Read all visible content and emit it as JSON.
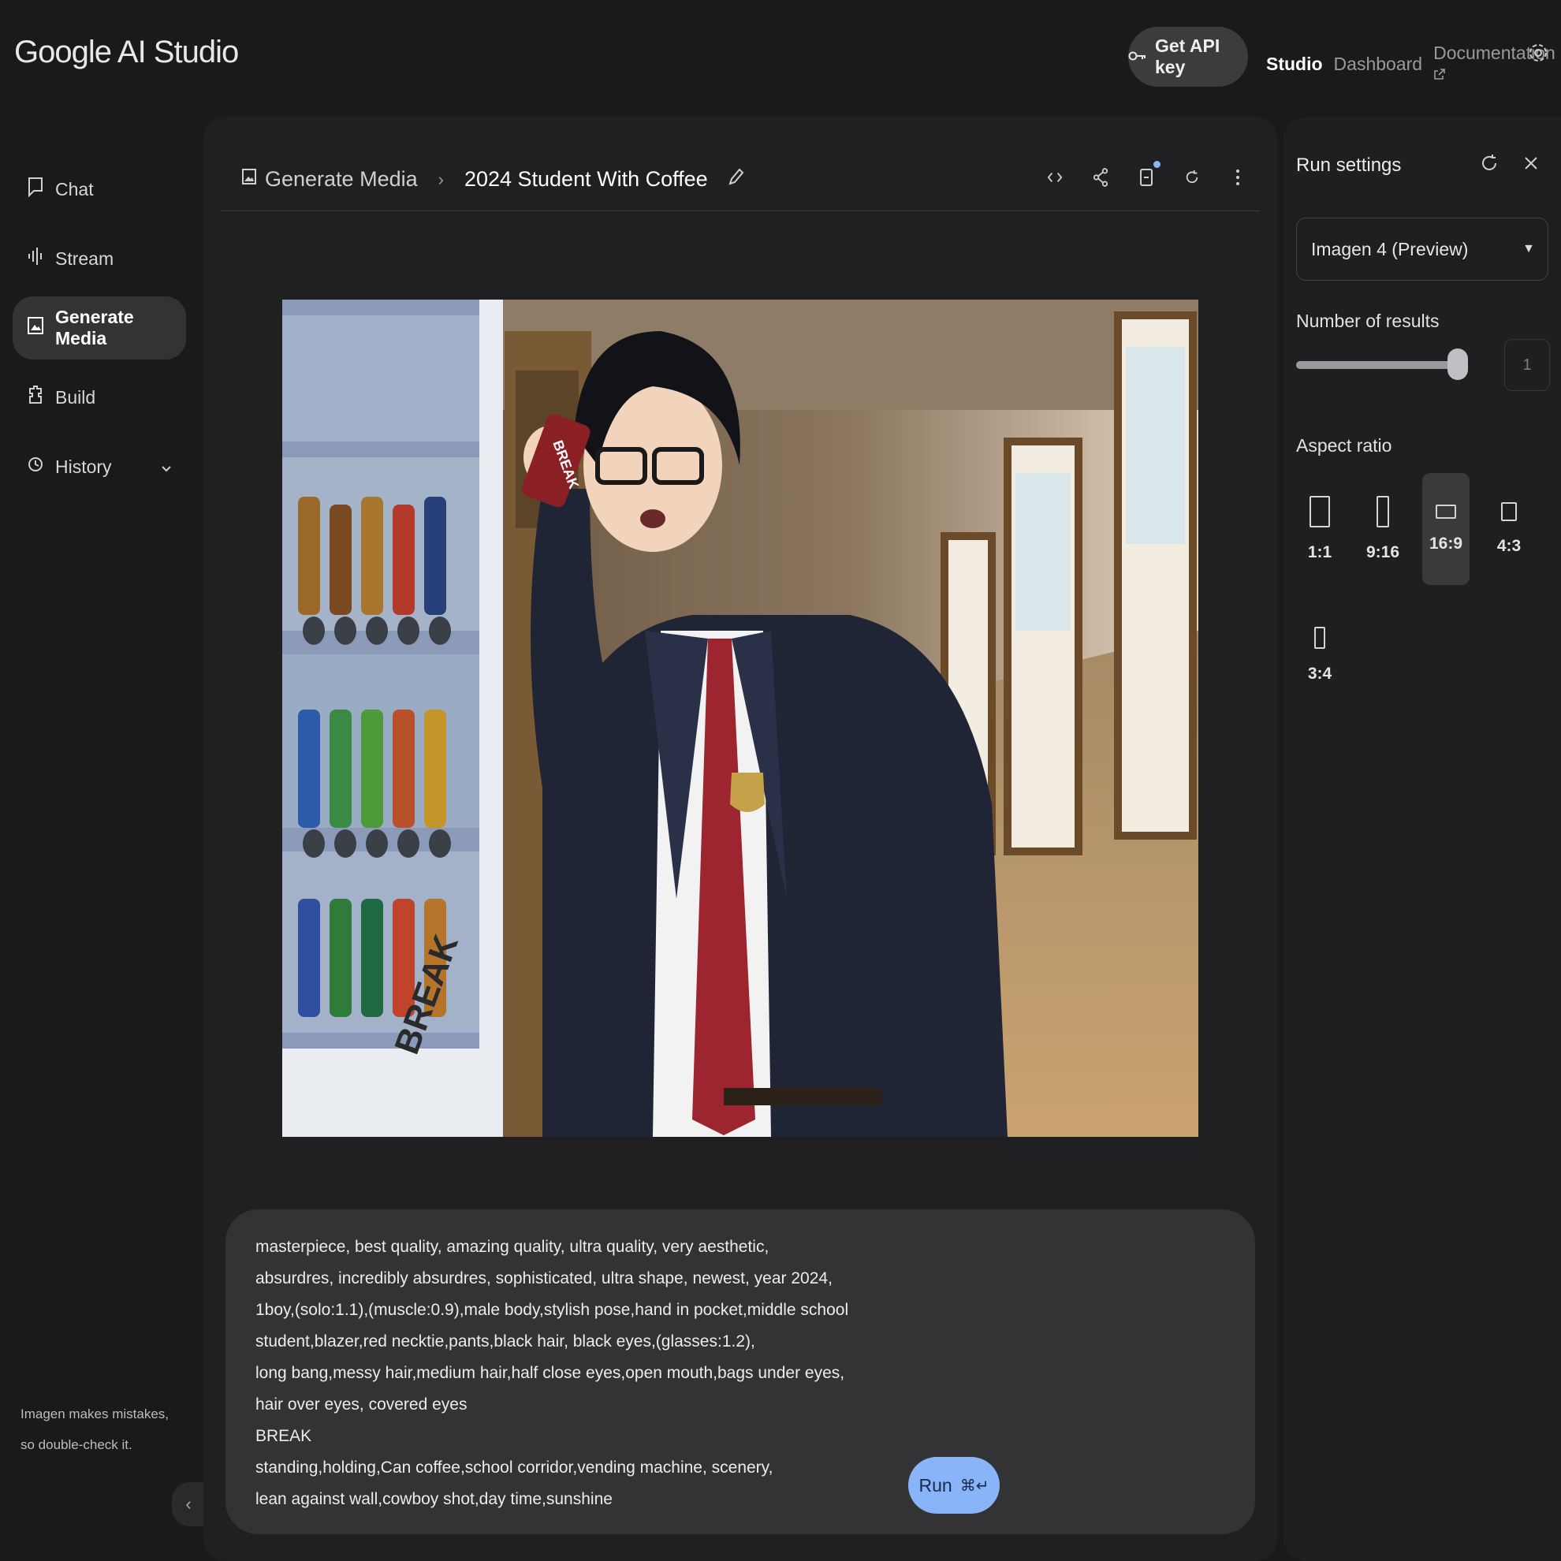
{
  "header": {
    "logo": "Google AI Studio",
    "api_key_button": "Get API key",
    "nav": {
      "studio": "Studio",
      "dashboard": "Dashboard",
      "documentation": "Documentation"
    }
  },
  "sidebar": {
    "items": [
      {
        "label": "Chat",
        "icon": "chat-icon"
      },
      {
        "label": "Stream",
        "icon": "stream-icon"
      },
      {
        "label": "Generate Media",
        "icon": "image-icon",
        "active": true
      },
      {
        "label": "Build",
        "icon": "build-icon"
      },
      {
        "label": "History",
        "icon": "history-icon"
      }
    ],
    "disclaimer": "Imagen makes mistakes, so double-check it."
  },
  "breadcrumb": {
    "parent": "Generate Media",
    "current": "2024 Student With Coffee"
  },
  "image_texts": {
    "vending_brand": "BREAK",
    "can_label": "BREAK"
  },
  "prompt": {
    "text": "masterpiece, best quality, amazing quality, ultra quality, very aesthetic,\nabsurdres, incredibly absurdres, sophisticated, ultra shape, newest, year 2024,\n1boy,(solo:1.1),(muscle:0.9),male body,stylish pose,hand in pocket,middle school\nstudent,blazer,red necktie,pants,black hair, black eyes,(glasses:1.2),\nlong bang,messy hair,medium hair,half close eyes,open mouth,bags under eyes,\nhair over eyes, covered eyes\nBREAK\nstanding,holding,Can coffee,school corridor,vending machine, scenery,\nlean against wall,cowboy shot,day time,sunshine"
  },
  "run_button": {
    "label": "Run",
    "shortcut": "⌘↵"
  },
  "run_settings": {
    "title": "Run settings",
    "model": "Imagen 4 (Preview)",
    "results_label": "Number of results",
    "results_value": "1",
    "results_fraction": 1.0,
    "aspect_label": "Aspect ratio",
    "ratios": [
      {
        "label": "1:1",
        "active": false
      },
      {
        "label": "9:16",
        "active": false
      },
      {
        "label": "16:9",
        "active": true
      },
      {
        "label": "4:3",
        "active": false
      },
      {
        "label": "3:4",
        "active": false
      }
    ]
  },
  "colors": {
    "accent": "#8ab4f8",
    "background": "#1a1a1b",
    "panel": "#202022",
    "tie": "#9d2530",
    "blazer": "#1f2535"
  }
}
